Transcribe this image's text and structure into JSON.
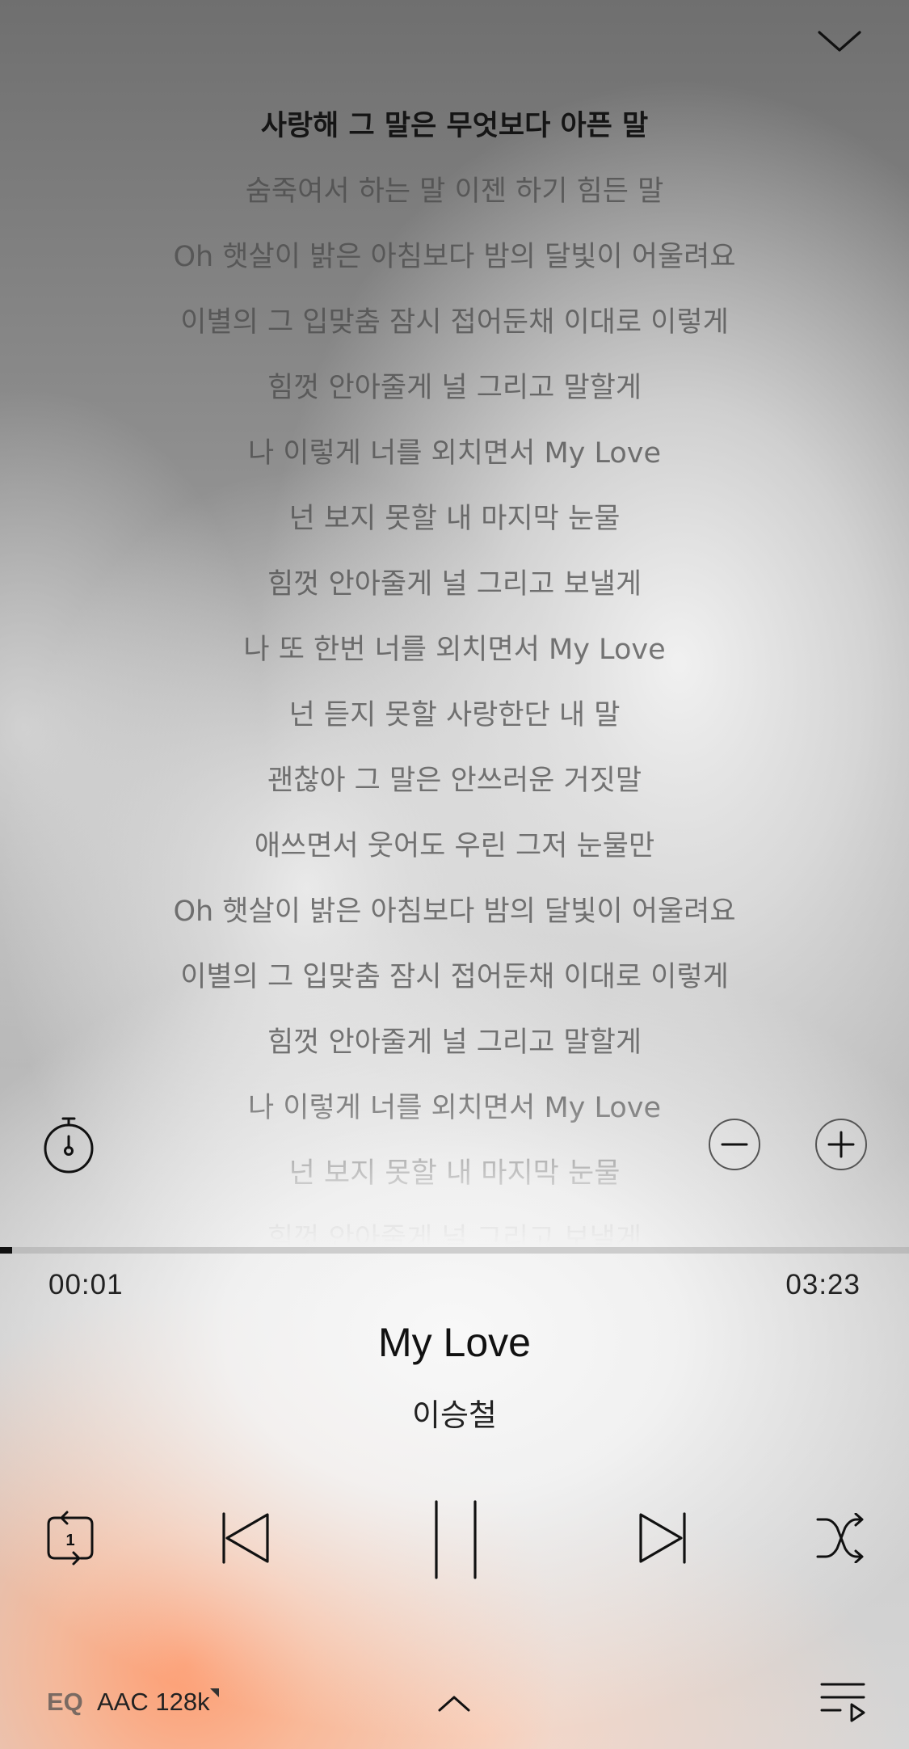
{
  "lyrics": {
    "current_index": 0,
    "lines": [
      "사랑해 그 말은 무엇보다 아픈 말",
      "숨죽여서 하는 말 이젠 하기 힘든 말",
      "Oh 햇살이 밝은 아침보다 밤의 달빛이 어울려요",
      "이별의 그 입맞춤 잠시 접어둔채 이대로 이렇게",
      "힘껏 안아줄게 널 그리고 말할게",
      "나 이렇게 너를 외치면서 My Love",
      "넌 보지 못할 내 마지막 눈물",
      "힘껏 안아줄게 널 그리고 보낼게",
      "나 또 한번 너를 외치면서 My Love",
      "넌 듣지 못할 사랑한단 내 말",
      "괜찮아 그 말은 안쓰러운 거짓말",
      "애쓰면서 웃어도 우린 그저 눈물만",
      "Oh 햇살이 밝은 아침보다 밤의 달빛이 어울려요",
      "이별의 그 입맞춤 잠시 접어둔채 이대로 이렇게",
      "힘껏 안아줄게 널 그리고 말할게",
      "나 이렇게 너를 외치면서 My Love",
      "넌 보지 못할 내 마지막 눈물",
      "힘껏 안아줄게 널 그리고 보낼게"
    ]
  },
  "player": {
    "elapsed": "00:01",
    "duration": "03:23",
    "progress_fraction": 0.005,
    "title": "My Love",
    "artist": "이승철",
    "repeat_mode": "repeat-one",
    "repeat_badge": "1",
    "is_playing": true
  },
  "footer": {
    "eq_label": "EQ",
    "quality_label": "AAC 128k"
  },
  "icons": {
    "collapse": "chevron-down-icon",
    "timer": "stopwatch-icon",
    "font_smaller": "minus-circle-icon",
    "font_larger": "plus-circle-icon",
    "repeat": "repeat-one-icon",
    "previous": "skip-previous-icon",
    "pause": "pause-icon",
    "next": "skip-next-icon",
    "shuffle": "shuffle-icon",
    "expand": "chevron-up-icon",
    "playlist": "playlist-icon"
  },
  "colors": {
    "text_primary": "#111111",
    "lyric_inactive": "#5a5a5a",
    "eq_accent": "#7a6a62",
    "glow_orange": "#ff9b6e"
  }
}
